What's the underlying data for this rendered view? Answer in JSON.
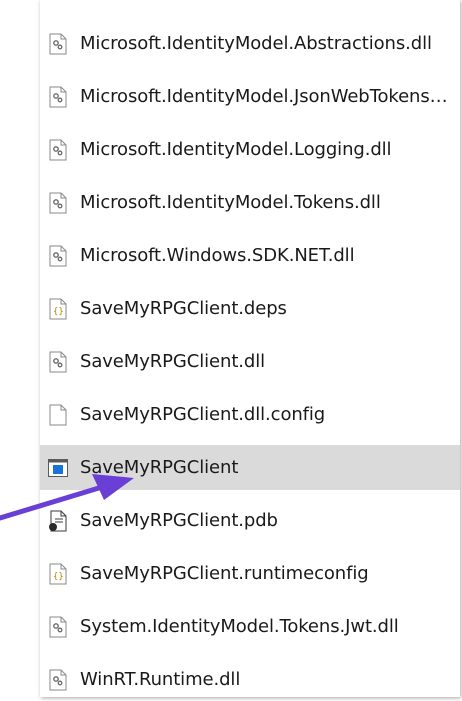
{
  "files": [
    {
      "name": "Microsoft.IdentityModel.Abstractions.dll",
      "icon": "dll-gear-icon"
    },
    {
      "name": "Microsoft.IdentityModel.JsonWebTokens....",
      "icon": "dll-gear-icon"
    },
    {
      "name": "Microsoft.IdentityModel.Logging.dll",
      "icon": "dll-gear-icon"
    },
    {
      "name": "Microsoft.IdentityModel.Tokens.dll",
      "icon": "dll-gear-icon"
    },
    {
      "name": "Microsoft.Windows.SDK.NET.dll",
      "icon": "dll-gear-icon"
    },
    {
      "name": "SaveMyRPGClient.deps",
      "icon": "json-file-icon"
    },
    {
      "name": "SaveMyRPGClient.dll",
      "icon": "dll-gear-icon"
    },
    {
      "name": "SaveMyRPGClient.dll.config",
      "icon": "blank-file-icon"
    },
    {
      "name": "SaveMyRPGClient",
      "icon": "application-icon",
      "selected": true
    },
    {
      "name": "SaveMyRPGClient.pdb",
      "icon": "pdb-file-icon"
    },
    {
      "name": "SaveMyRPGClient.runtimeconfig",
      "icon": "json-file-icon"
    },
    {
      "name": "System.IdentityModel.Tokens.Jwt.dll",
      "icon": "dll-gear-icon"
    },
    {
      "name": "WinRT.Runtime.dll",
      "icon": "dll-gear-icon"
    }
  ],
  "annotation": {
    "icon": "pointer-arrow-icon",
    "color": "#6a3fd6"
  },
  "colors": {
    "selected_row": "#dadada",
    "text": "#1a1a1a"
  }
}
